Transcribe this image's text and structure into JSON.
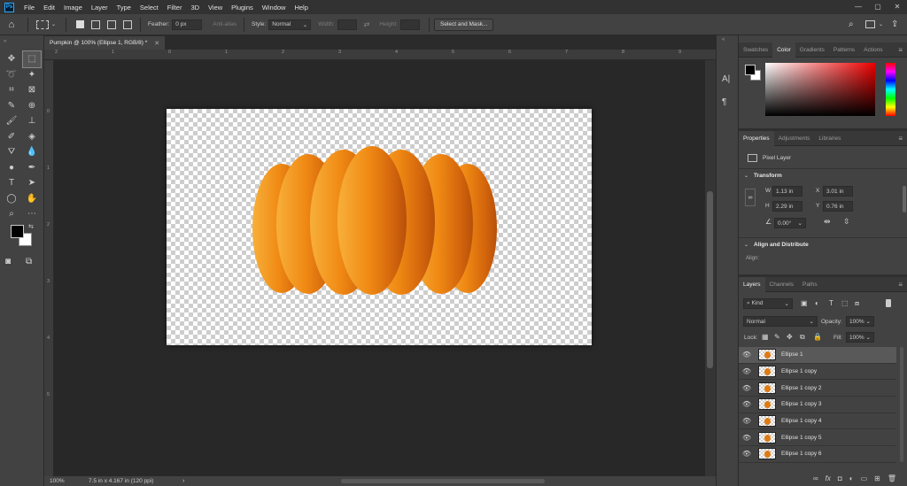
{
  "menu": {
    "logo": "Ps",
    "items": [
      "File",
      "Edit",
      "Image",
      "Layer",
      "Type",
      "Select",
      "Filter",
      "3D",
      "View",
      "Plugins",
      "Window",
      "Help"
    ]
  },
  "options": {
    "feather_label": "Feather:",
    "feather_value": "0 px",
    "anti_alias": "Anti-alias",
    "style_label": "Style:",
    "style_value": "Normal",
    "width_label": "Width:",
    "height_label": "Height:",
    "select_mask": "Select and Mask..."
  },
  "document": {
    "tab_title": "Pumpkin @ 100% (Ellipse 1, RGB/8) *",
    "zoom": "100%",
    "doc_info": "7.5 in x 4.167 in (120 ppi)"
  },
  "ruler": {
    "top": [
      "2",
      "1",
      "0",
      "1",
      "2",
      "3",
      "4",
      "5",
      "6",
      "7",
      "8",
      "9"
    ],
    "left": [
      "0",
      "1",
      "2",
      "3",
      "4",
      "5"
    ]
  },
  "color_panel": {
    "tabs": [
      "Swatches",
      "Color",
      "Gradients",
      "Patterns",
      "Actions"
    ],
    "active": "Color"
  },
  "properties_panel": {
    "tabs": [
      "Properties",
      "Adjustments",
      "Libraries"
    ],
    "layer_type": "Pixel Layer",
    "transform_title": "Transform",
    "w_label": "W",
    "w": "1.13 in",
    "x_label": "X",
    "x": "3.01 in",
    "h_label": "H",
    "h": "2.29 in",
    "y_label": "Y",
    "y": "0.76 in",
    "angle": "0.00°",
    "align_title": "Align and Distribute",
    "align_label": "Align:"
  },
  "layers_panel": {
    "tabs": [
      "Layers",
      "Channels",
      "Paths"
    ],
    "filter_kind": "Kind",
    "blend_mode": "Normal",
    "opacity_label": "Opacity:",
    "opacity": "100%",
    "lock_label": "Lock:",
    "fill_label": "Fill:",
    "fill": "100%",
    "layers": [
      "Ellipse 1",
      "Ellipse 1 copy",
      "Ellipse 1 copy 2",
      "Ellipse 1 copy 3",
      "Ellipse 1 copy 4",
      "Ellipse 1 copy 5",
      "Ellipse 1 copy 6"
    ],
    "selected_index": 0,
    "footer_icons": [
      "link-icon",
      "fx-icon",
      "mask-icon",
      "adjustment-icon",
      "group-icon",
      "new-layer-icon",
      "trash-icon"
    ]
  },
  "colors": {
    "pumpkin_light": "#f5a623",
    "pumpkin_dark": "#c4590a",
    "foreground": "#000000",
    "background": "#ffffff"
  }
}
